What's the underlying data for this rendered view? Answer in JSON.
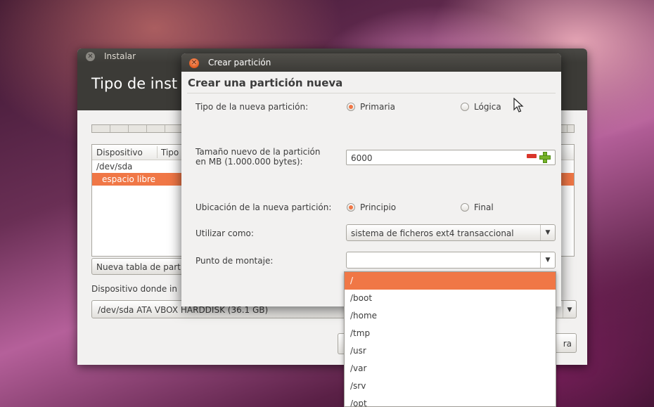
{
  "installer": {
    "title": "Instalar",
    "heading": "Tipo de inst",
    "table": {
      "columns": [
        "Dispositivo",
        "Tipo"
      ],
      "rows": [
        "/dev/sda",
        "espacio libre"
      ]
    },
    "new_table_button": "Nueva tabla de part",
    "boot_device_label": "Dispositivo donde in",
    "boot_device_value": "/dev/sda  ATA VBOX HARDDISK (36.1 GB)",
    "right_button": "ra"
  },
  "dialog": {
    "title": "Crear partición",
    "heading": "Crear una partición nueva",
    "type_label": "Tipo de la nueva partición:",
    "type_primary": "Primaria",
    "type_logical": "Lógica",
    "type_selected": "Primaria",
    "size_label_line1": "Tamaño nuevo de la partición",
    "size_label_line2": "en MB (1.000.000 bytes):",
    "size_value": "6000",
    "location_label": "Ubicación de la nueva partición:",
    "location_start": "Principio",
    "location_end": "Final",
    "location_selected": "Principio",
    "use_as_label": "Utilizar como:",
    "use_as_value": "sistema de ficheros ext4 transaccional",
    "mount_label": "Punto de montaje:",
    "mount_value": ""
  },
  "mount_dropdown": {
    "options": [
      "/",
      "/boot",
      "/home",
      "/tmp",
      "/usr",
      "/var",
      "/srv",
      "/opt"
    ],
    "highlighted": "/"
  },
  "colors": {
    "accent": "#f07746",
    "titlebar": "#3c3b37",
    "window_bg": "#f2f1f0"
  }
}
